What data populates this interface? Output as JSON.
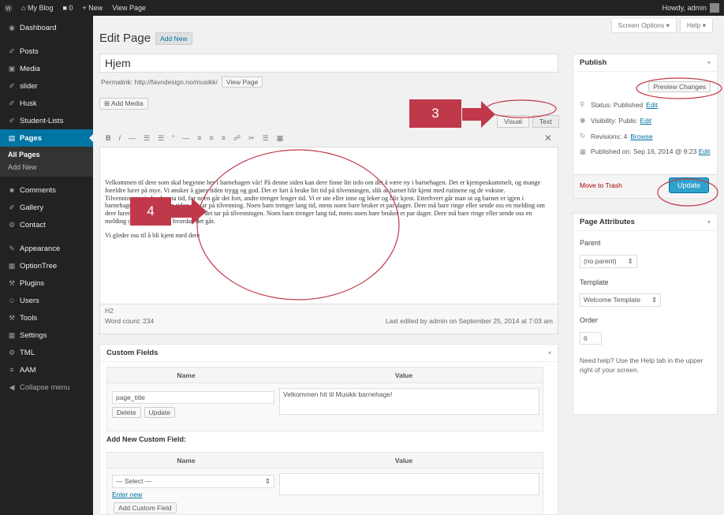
{
  "adminbar": {
    "wp_logo": "Ⓦ",
    "home": "⌂ My Blog",
    "comments": "■ 0",
    "new": "+ New",
    "view_page": "View Page",
    "howdy": "Howdy, admin"
  },
  "sidebar": {
    "items": [
      {
        "icon": "◉",
        "label": "Dashboard"
      },
      {
        "icon": "✐",
        "label": "Posts"
      },
      {
        "icon": "▣",
        "label": "Media"
      },
      {
        "icon": "✐",
        "label": "slider"
      },
      {
        "icon": "✐",
        "label": "Husk"
      },
      {
        "icon": "✐",
        "label": "Student-Lists"
      },
      {
        "icon": "▤",
        "label": "Pages"
      },
      {
        "icon": "■",
        "label": "Comments"
      },
      {
        "icon": "✐",
        "label": "Gallery"
      },
      {
        "icon": "⚙",
        "label": "Contact"
      },
      {
        "icon": "✎",
        "label": "Appearance"
      },
      {
        "icon": "▦",
        "label": "OptionTree"
      },
      {
        "icon": "⚒",
        "label": "Plugins"
      },
      {
        "icon": "☺",
        "label": "Users"
      },
      {
        "icon": "⚒",
        "label": "Tools"
      },
      {
        "icon": "▦",
        "label": "Settings"
      },
      {
        "icon": "⚙",
        "label": "TML"
      },
      {
        "icon": "≡",
        "label": "AAM"
      },
      {
        "icon": "◀",
        "label": "Collapse menu"
      }
    ],
    "submenu": [
      "All Pages",
      "Add New"
    ]
  },
  "screen_options": "Screen Options ▾",
  "help": "Help ▾",
  "page_title": "Edit Page",
  "add_new": "Add New",
  "post_title": "Hjem",
  "permalink_label": "Permalink: http://favndesign.no/musikk/",
  "view_page_btn": "View Page",
  "add_media": "⊞ Add Media",
  "editor_tabs": {
    "visual": "Visual",
    "text": "Text"
  },
  "toolbar_icons": [
    "B",
    "I",
    "—",
    "☰",
    "☰",
    "“",
    "—",
    "≡",
    "≡",
    "≡",
    "☍",
    "✂",
    "☰",
    "▦"
  ],
  "toolbar_close": "✕",
  "content": {
    "p1": "Velkommen til dere som skal begynne her i barnehagen vår! På denne siden kan dere finne litt info om det å være ny i barnehagen. Det er kjempeskummelt, og mange foreldre lurer på mye. Vi ønsker å gjøre tiden trygg og god. Det er lurt å bruke litt tid på tilvenningen, slik at barnet blir kjent med rutinene og de voksne. Tilvenningsperioden kan ta tid, for noen går det fort, andre trenger lenger tid. Vi er ute eller inne og leker og blir kjent. Etterhvert går man ut og barnet er igjen i barnehagen. Vi bruker den tiden det tar på tilvenning. Noen barn trenger lang tid, mens noen bare bruker et par dager. Dere må bare ringe eller sende oss en melding om dere lurer på noe. Vi bruker den tiden det tar på tilvenningen. Noen barn trenger lang tid, mens noen bare bruker et par dager. Dere må bare ringe eller sende oss en melding om dere lurer på hvordan det går.",
    "p2": "Vi gleder oss til å bli kjent med dere"
  },
  "editor_path": "H2",
  "word_count": "Word count: 234",
  "last_edited": "Last edited by admin on September 25, 2014 at 7:03 am",
  "custom_fields": {
    "title": "Custom Fields",
    "col_name": "Name",
    "col_value": "Value",
    "row_name": "page_title",
    "row_value": "Velkommen hit til Musikk barnehage!",
    "delete": "Delete",
    "update": "Update",
    "add_new_title": "Add New Custom Field:",
    "select": "— Select —",
    "enter_new": "Enter new",
    "add_btn": "Add Custom Field"
  },
  "publish": {
    "title": "Publish",
    "preview": "Preview Changes",
    "status": "Status: Published",
    "visibility": "Visibility: Public",
    "revisions": "Revisions: 4",
    "browse": "Browse",
    "published_on": "Published on: Sep 16, 2014 @ 9:23",
    "edit": "Edit",
    "trash": "Move to Trash",
    "update": "Update"
  },
  "page_attributes": {
    "title": "Page Attributes",
    "parent_label": "Parent",
    "parent_value": "(no parent)",
    "template_label": "Template",
    "template_value": "Welcome Template",
    "order_label": "Order",
    "order_value": "6",
    "help_text": "Need help? Use the Help tab in the upper right of your screen."
  },
  "annotations": {
    "callout3": "3",
    "callout4": "4",
    "color": "#c0394b"
  }
}
